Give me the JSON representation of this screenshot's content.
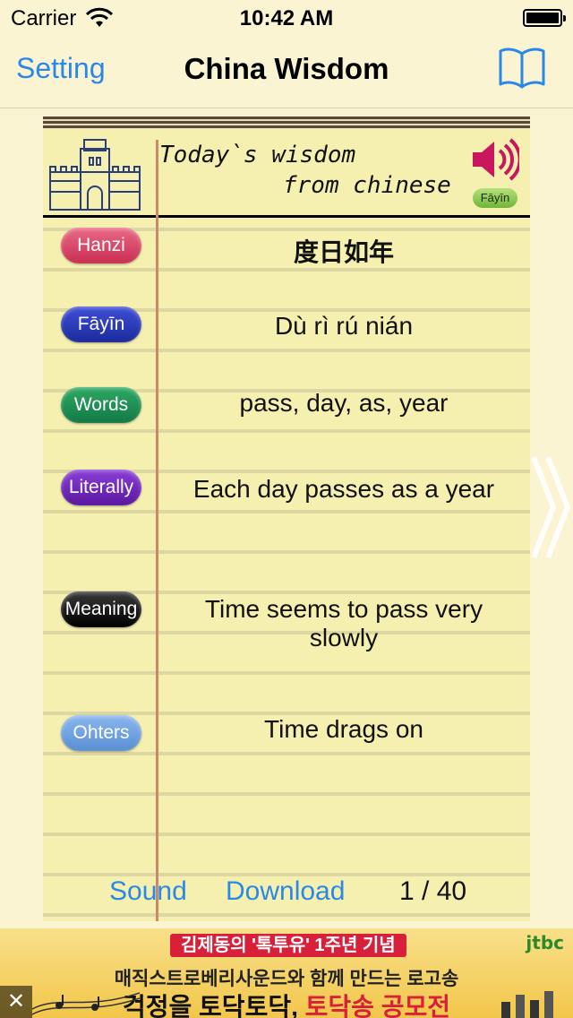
{
  "status_bar": {
    "carrier": "Carrier",
    "time": "10:42 AM"
  },
  "nav": {
    "setting_label": "Setting",
    "title": "China Wisdom",
    "book_icon": "book-icon"
  },
  "notepad": {
    "header_line1": "Today`s wisdom",
    "header_line2": "from chinese",
    "speaker_badge": "Fāyīn",
    "rows": [
      {
        "label": "Hanzi",
        "value": "度日如年"
      },
      {
        "label": "Fāyīn",
        "value": "Dù rì rú nián"
      },
      {
        "label": "Words",
        "value": "pass, day, as, year"
      },
      {
        "label": "Literally",
        "value": "Each day passes as a year"
      },
      {
        "label": "Meaning",
        "value": "Time seems to pass very slowly"
      },
      {
        "label": "Ohters",
        "value": "Time drags on"
      }
    ]
  },
  "footer": {
    "sound_label": "Sound",
    "download_label": "Download",
    "page_counter": "1 / 40"
  },
  "ad": {
    "line1": "김제동의 '톡투유' 1주년 기념",
    "line2": "매직스트로베리사운드와 함께 만드는 로고송",
    "line3_a": "걱정을 토닥토닥, ",
    "line3_b": "토닥송 공모전",
    "brand": "jtbc",
    "close": "✕"
  },
  "colors": {
    "accent_blue": "#2a88e8",
    "pill_hanzi": "#c92e52",
    "pill_fayin": "#1c2a9c",
    "pill_words": "#137a45",
    "pill_literally": "#5a189f",
    "pill_meaning": "#000000",
    "pill_others": "#5a8fd3"
  }
}
